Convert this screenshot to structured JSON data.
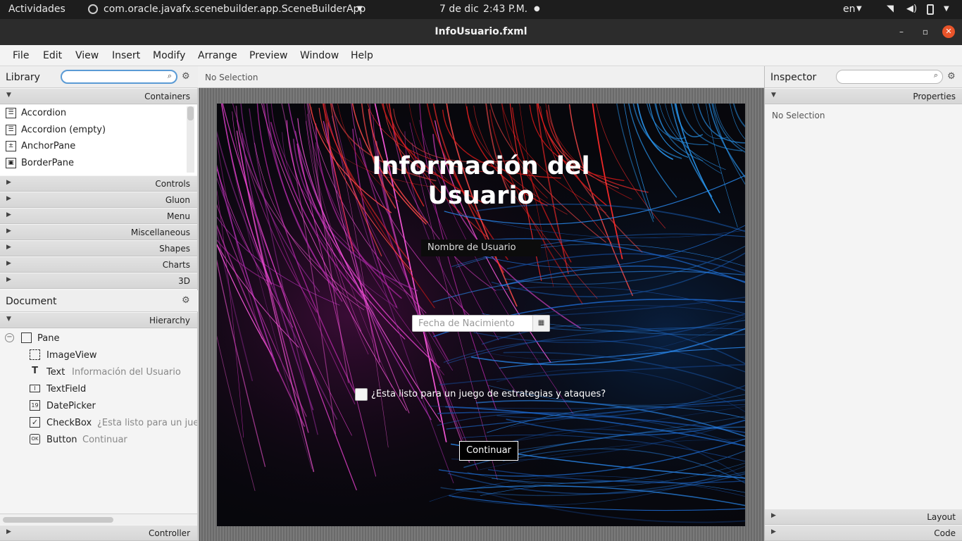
{
  "topbar": {
    "activities": "Actividades",
    "app_name": "com.oracle.javafx.scenebuilder.app.SceneBuilderApp",
    "date": "7 de dic",
    "time": "2:43 P.M.",
    "lang": "en"
  },
  "window": {
    "title": "InfoUsuario.fxml"
  },
  "menu": [
    "File",
    "Edit",
    "View",
    "Insert",
    "Modify",
    "Arrange",
    "Preview",
    "Window",
    "Help"
  ],
  "library": {
    "title": "Library",
    "containers_label": "Containers",
    "items": [
      "Accordion",
      "Accordion  (empty)",
      "AnchorPane",
      "BorderPane"
    ],
    "sections": [
      "Controls",
      "Gluon",
      "Menu",
      "Miscellaneous",
      "Shapes",
      "Charts",
      "3D"
    ]
  },
  "document": {
    "title": "Document",
    "hierarchy_label": "Hierarchy",
    "root": "Pane",
    "nodes": [
      {
        "type": "ImageView",
        "detail": ""
      },
      {
        "type": "Text",
        "detail": "Información del Usuario"
      },
      {
        "type": "TextField",
        "detail": ""
      },
      {
        "type": "DatePicker",
        "detail": ""
      },
      {
        "type": "CheckBox",
        "detail": "¿Esta listo para un jue"
      },
      {
        "type": "Button",
        "detail": "Continuar"
      }
    ],
    "controller_label": "Controller"
  },
  "center": {
    "selection": "No Selection"
  },
  "form": {
    "title_line1": "Información del",
    "title_line2": "Usuario",
    "username_placeholder": "Nombre de Usuario",
    "date_placeholder": "Fecha de Nacimiento",
    "checkbox_label": "¿Esta listo para un juego de estrategias y ataques?",
    "button_label": "Continuar"
  },
  "inspector": {
    "title": "Inspector",
    "properties_label": "Properties",
    "selection": "No Selection",
    "layout_label": "Layout",
    "code_label": "Code"
  }
}
